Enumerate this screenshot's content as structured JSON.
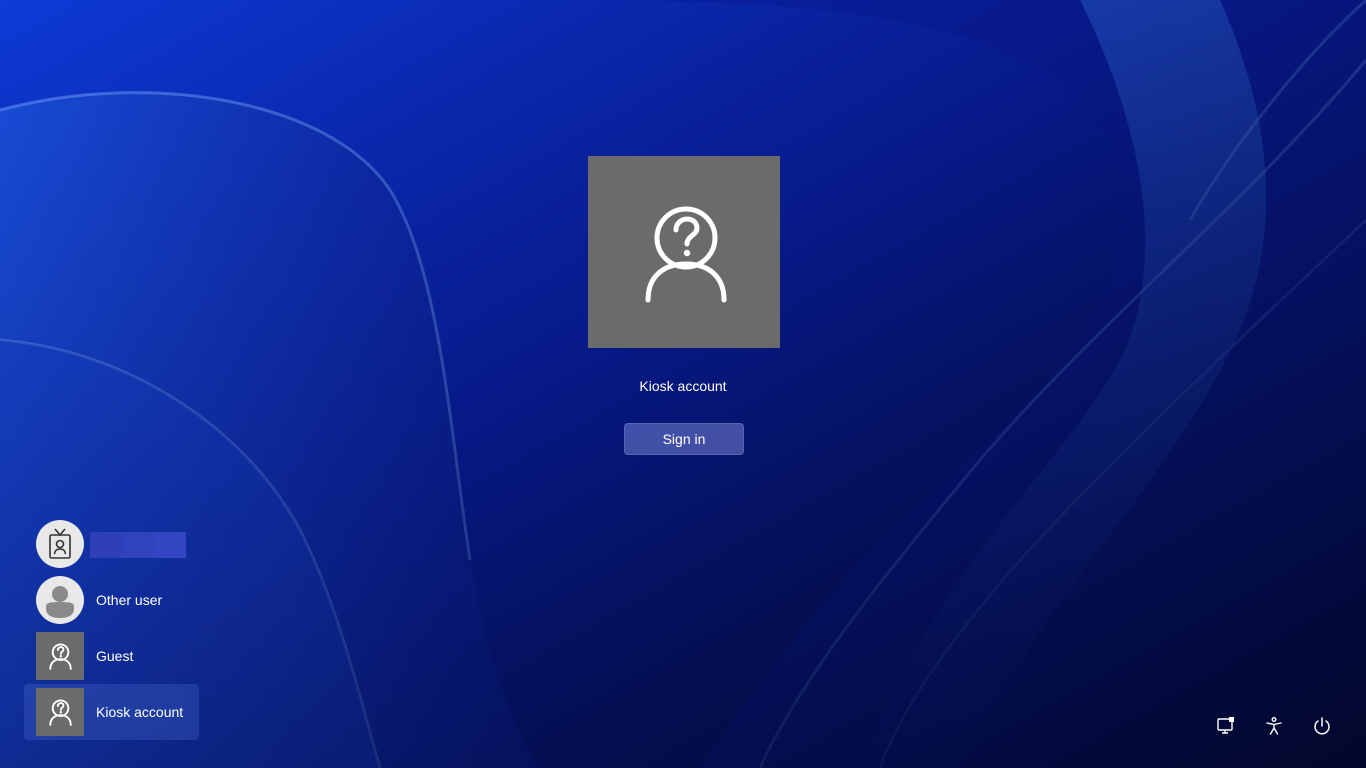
{
  "colors": {
    "accent": "#0b1fa8",
    "tile_gray": "#6b6b6b",
    "text": "#ffffff"
  },
  "center": {
    "icon": "unknown-user-icon",
    "account_name": "Kiosk account",
    "sign_in_label": "Sign in"
  },
  "users": [
    {
      "label": "",
      "icon": "badge-icon",
      "redacted": true
    },
    {
      "label": "Other user",
      "icon": "person-silhouette-icon"
    },
    {
      "label": "Guest",
      "icon": "unknown-user-icon"
    },
    {
      "label": "Kiosk account",
      "icon": "unknown-user-icon",
      "selected": true
    }
  ],
  "system_icons": [
    "network-icon",
    "accessibility-icon",
    "power-icon"
  ]
}
